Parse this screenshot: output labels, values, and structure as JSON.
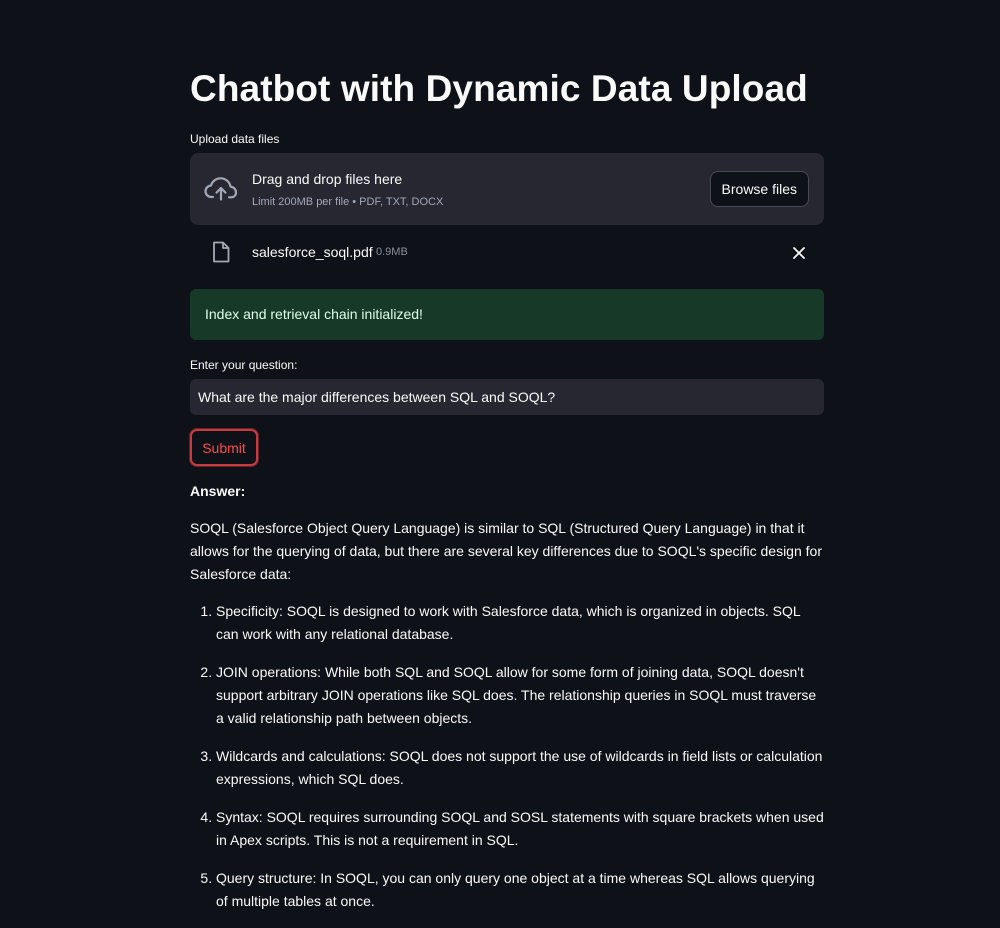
{
  "page": {
    "title": "Chatbot with Dynamic Data Upload"
  },
  "uploader": {
    "label": "Upload data files",
    "drop_title": "Drag and drop files here",
    "drop_subtitle": "Limit 200MB per file • PDF, TXT, DOCX",
    "browse_label": "Browse files",
    "icon": "cloud-upload-icon"
  },
  "uploaded_file": {
    "name": "salesforce_soql.pdf",
    "size": "0.9MB",
    "icon": "file-icon",
    "remove_icon": "close-icon"
  },
  "status": {
    "message": "Index and retrieval chain initialized!",
    "color": "#173928"
  },
  "question": {
    "label": "Enter your question:",
    "value": "What are the major differences between SQL and SOQL?"
  },
  "submit": {
    "label": "Submit",
    "color": "#ff4b4b"
  },
  "answer": {
    "label": "Answer:",
    "intro": "SOQL (Salesforce Object Query Language) is similar to SQL (Structured Query Language) in that it allows for the querying of data, but there are several key differences due to SOQL's specific design for Salesforce data:",
    "items": [
      "Specificity: SOQL is designed to work with Salesforce data, which is organized in objects. SQL can work with any relational database.",
      "JOIN operations: While both SQL and SOQL allow for some form of joining data, SOQL doesn't support arbitrary JOIN operations like SQL does. The relationship queries in SOQL must traverse a valid relationship path between objects.",
      "Wildcards and calculations: SOQL does not support the use of wildcards in field lists or calculation expressions, which SQL does.",
      "Syntax: SOQL requires surrounding SOQL and SOSL statements with square brackets when used in Apex scripts. This is not a requirement in SQL.",
      "Query structure: In SOQL, you can only query one object at a time whereas SQL allows querying of multiple tables at once."
    ]
  }
}
